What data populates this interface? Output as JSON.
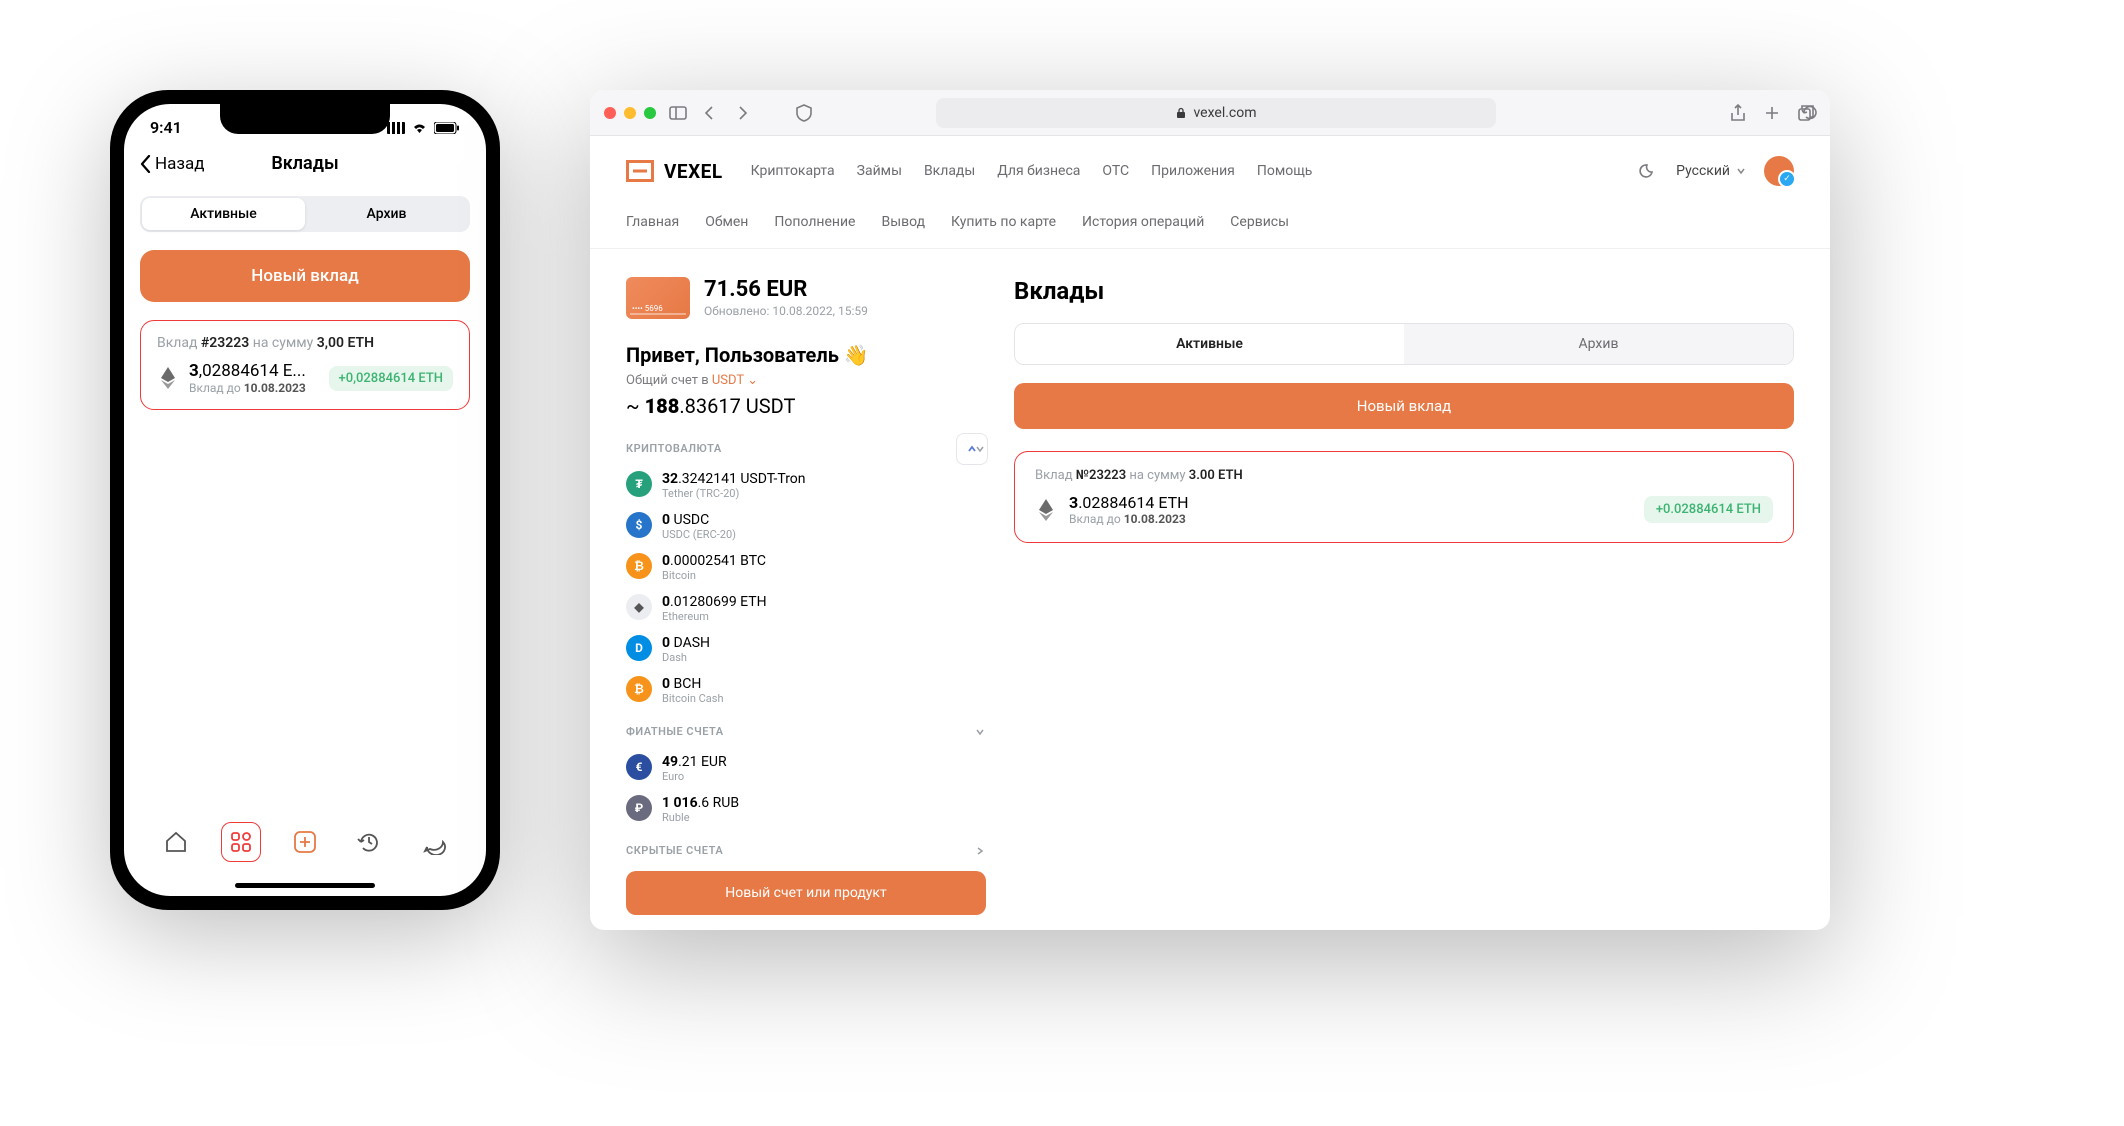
{
  "phone": {
    "status_time": "9:41",
    "back_label": "Назад",
    "title": "Вклады",
    "tab_active": "Активные",
    "tab_archive": "Архив",
    "new_deposit_btn": "Новый вклад",
    "card": {
      "prefix": "Вклад ",
      "id": "#23223",
      "middle": " на сумму ",
      "amount_init": "3,00 ETH",
      "amount_int": "3",
      "amount_frac": ",02884614 E...",
      "sub_prefix": "Вклад до ",
      "sub_date": "10.08.2023",
      "badge": "+0,02884614 ETH"
    }
  },
  "mac": {
    "url_host": "vexel.com",
    "logo_text": "VEXEL",
    "topnav": [
      "Криптокарта",
      "Займы",
      "Вклады",
      "Для бизнеса",
      "OTC",
      "Приложения",
      "Помощь"
    ],
    "lang": "Русский",
    "subnav": [
      "Главная",
      "Обмен",
      "Пополнение",
      "Вывод",
      "Купить по карте",
      "История операций",
      "Сервисы"
    ],
    "balance": {
      "card_last4": "•••• 5696",
      "main": "71.56 EUR",
      "sub": "Обновлено: 10.08.2022, 15:59"
    },
    "greet": "Привет, Пользователь 👋",
    "greet_sub_pre": "Общий счет в ",
    "greet_sub_cur": "USDT",
    "total_pre": "~ ",
    "total_int": "188",
    "total_frac": ".83617 USDT",
    "sec_crypto": "КРИПТОВАЛЮТА",
    "sec_fiat": "ФИАТНЫЕ СЧЕТА",
    "sec_hidden": "СКРЫТЫЕ СЧЕТА",
    "assets_crypto": [
      {
        "int": "32",
        "frac": ".3242141 USDT-Tron",
        "sub": "Tether (TRC-20)",
        "color": "#26a17b",
        "sym": "₮"
      },
      {
        "int": "0",
        "frac": " USDC",
        "sub": "USDC (ERC-20)",
        "color": "#2775ca",
        "sym": "$"
      },
      {
        "int": "0",
        "frac": ".00002541 BTC",
        "sub": "Bitcoin",
        "color": "#f7931a",
        "sym": "₿"
      },
      {
        "int": "0",
        "frac": ".01280699 ETH",
        "sub": "Ethereum",
        "color": "#ecedf0",
        "sym": "◆"
      },
      {
        "int": "0",
        "frac": " DASH",
        "sub": "Dash",
        "color": "#008de4",
        "sym": "D"
      },
      {
        "int": "0",
        "frac": " BCH",
        "sub": "Bitcoin Cash",
        "color": "#f7931a",
        "sym": "₿"
      }
    ],
    "assets_fiat": [
      {
        "int": "49",
        "frac": ".21 EUR",
        "sub": "Euro",
        "color": "#2b4ea0",
        "sym": "€"
      },
      {
        "int": "1 016",
        "frac": ".6 RUB",
        "sub": "Ruble",
        "color": "#6b6b80",
        "sym": "₽"
      }
    ],
    "new_account_btn": "Новый счет или продукт",
    "right": {
      "title": "Вклады",
      "tab_active": "Активные",
      "tab_archive": "Архив",
      "new_deposit_btn": "Новый вклад",
      "card": {
        "prefix": "Вклад ",
        "id": "№23223",
        "middle": " на сумму ",
        "amount_init": "3.00 ETH",
        "amount_int": "3",
        "amount_frac": ".02884614 ETH",
        "sub_prefix": "Вклад до ",
        "sub_date": "10.08.2023",
        "badge": "+0.02884614 ETH"
      }
    }
  }
}
